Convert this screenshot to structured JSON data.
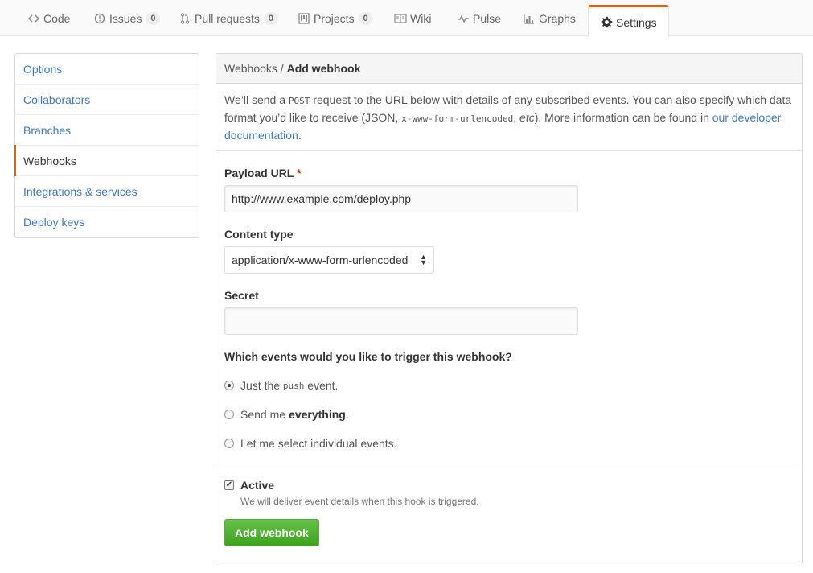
{
  "tabs": [
    {
      "label": "Code",
      "icon": "code-icon"
    },
    {
      "label": "Issues",
      "icon": "issue-icon",
      "count": "0"
    },
    {
      "label": "Pull requests",
      "icon": "pull-request-icon",
      "count": "0"
    },
    {
      "label": "Projects",
      "icon": "project-icon",
      "count": "0"
    },
    {
      "label": "Wiki",
      "icon": "book-icon"
    },
    {
      "label": "Pulse",
      "icon": "pulse-icon"
    },
    {
      "label": "Graphs",
      "icon": "graph-icon"
    },
    {
      "label": "Settings",
      "icon": "gear-icon",
      "selected": true
    }
  ],
  "menu": [
    {
      "label": "Options"
    },
    {
      "label": "Collaborators"
    },
    {
      "label": "Branches"
    },
    {
      "label": "Webhooks",
      "selected": true
    },
    {
      "label": "Integrations & services"
    },
    {
      "label": "Deploy keys"
    }
  ],
  "panel": {
    "breadcrumb_parent": "Webhooks",
    "breadcrumb_sep": " / ",
    "breadcrumb_current": "Add webhook",
    "intro": {
      "part1": "We’ll send a ",
      "code1": "POST",
      "part2": " request to the URL below with details of any subscribed events. You can also specify which data format you’d like to receive (JSON, ",
      "code2": "x-www-form-urlencoded",
      "part3": ", ",
      "etc": "etc",
      "part4": "). More information can be found in ",
      "link": "our developer documentation",
      "part5": "."
    }
  },
  "form": {
    "payload_label": "Payload URL",
    "required_mark": "*",
    "payload_value": "http://www.example.com/deploy.php",
    "content_type_label": "Content type",
    "content_type_value": "application/x-www-form-urlencoded",
    "secret_label": "Secret",
    "secret_value": "",
    "events_label": "Which events would you like to trigger this webhook?",
    "events": [
      {
        "pre": "Just the ",
        "code": "push",
        "post": " event.",
        "checked": true
      },
      {
        "pre": "Send me",
        "bold": "everything",
        "post": ".",
        "checked": false
      },
      {
        "pre": "Let me select individual events.",
        "checked": false
      }
    ],
    "active_label": "Active",
    "active_checked": true,
    "active_note": "We will deliver event details when this hook is triggered.",
    "submit_label": "Add webhook"
  },
  "colors": {
    "accent": "#e36209",
    "link": "#4078c0",
    "button": "#3ea21d"
  }
}
